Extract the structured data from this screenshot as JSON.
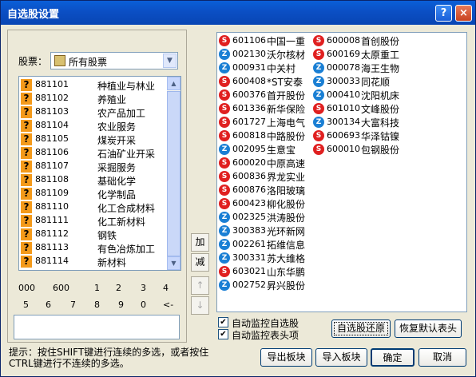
{
  "window": {
    "title": "自选股设置",
    "help_label": "?",
    "close_label": "×"
  },
  "stock_label": "股票：",
  "combo": {
    "value": "所有股票",
    "arrow": "▼"
  },
  "left_items": [
    {
      "code": "881101",
      "name": "种植业与林业"
    },
    {
      "code": "881102",
      "name": "养殖业"
    },
    {
      "code": "881103",
      "name": "农产品加工"
    },
    {
      "code": "881104",
      "name": "农业服务"
    },
    {
      "code": "881105",
      "name": "煤炭开采"
    },
    {
      "code": "881106",
      "name": "石油矿业开采"
    },
    {
      "code": "881107",
      "name": "采掘服务"
    },
    {
      "code": "881108",
      "name": "基础化学"
    },
    {
      "code": "881109",
      "name": "化学制品"
    },
    {
      "code": "881110",
      "name": "化工合成材料"
    },
    {
      "code": "881111",
      "name": "化工新材料"
    },
    {
      "code": "881112",
      "name": "钢铁"
    },
    {
      "code": "881113",
      "name": "有色冶炼加工"
    },
    {
      "code": "881114",
      "name": "新材料"
    }
  ],
  "keypad_row1": [
    "000",
    "600",
    "1",
    "2",
    "3",
    "4"
  ],
  "keypad_row2": [
    "5",
    "6",
    "7",
    "8",
    "9",
    "0",
    "<-"
  ],
  "add_label": "加",
  "remove_label": "减",
  "up_label": "↑",
  "down_label": "↓",
  "right_col1": [
    {
      "code": "601106",
      "name": "中国一重",
      "market": "sh"
    },
    {
      "code": "002130",
      "name": "沃尔核材",
      "market": "sz"
    },
    {
      "code": "000931",
      "name": "中关村",
      "market": "sz"
    },
    {
      "code": "600408",
      "name": "*ST安泰",
      "market": "sh"
    },
    {
      "code": "600376",
      "name": "首开股份",
      "market": "sh"
    },
    {
      "code": "601336",
      "name": "新华保险",
      "market": "sh"
    },
    {
      "code": "601727",
      "name": "上海电气",
      "market": "sh"
    },
    {
      "code": "600818",
      "name": "中路股份",
      "market": "sh"
    },
    {
      "code": "002095",
      "name": "生意宝",
      "market": "sz"
    },
    {
      "code": "600020",
      "name": "中原高速",
      "market": "sh"
    },
    {
      "code": "600836",
      "name": "界龙实业",
      "market": "sh"
    },
    {
      "code": "600876",
      "name": "洛阳玻璃",
      "market": "sh"
    },
    {
      "code": "600423",
      "name": "柳化股份",
      "market": "sh"
    },
    {
      "code": "002325",
      "name": "洪涛股份",
      "market": "sz"
    },
    {
      "code": "300383",
      "name": "光环新网",
      "market": "sz"
    },
    {
      "code": "002261",
      "name": "拓维信息",
      "market": "sz"
    },
    {
      "code": "300331",
      "name": "苏大维格",
      "market": "sz"
    },
    {
      "code": "603021",
      "name": "山东华鹏",
      "market": "sh"
    },
    {
      "code": "002752",
      "name": "昇兴股份",
      "market": "sz"
    }
  ],
  "right_col2": [
    {
      "code": "600008",
      "name": "首创股份",
      "market": "sh"
    },
    {
      "code": "600169",
      "name": "太原重工",
      "market": "sh"
    },
    {
      "code": "000078",
      "name": "海王生物",
      "market": "sz"
    },
    {
      "code": "300033",
      "name": "同花顺",
      "market": "sz"
    },
    {
      "code": "000410",
      "name": "沈阳机床",
      "market": "sz"
    },
    {
      "code": "601010",
      "name": "文峰股份",
      "market": "sh"
    },
    {
      "code": "300134",
      "name": "大富科技",
      "market": "sz"
    },
    {
      "code": "600693",
      "name": "华泽钴镍",
      "market": "sh"
    },
    {
      "code": "600010",
      "name": "包钢股份",
      "market": "sh"
    }
  ],
  "check1": {
    "label": "自动监控自选股",
    "checked": true
  },
  "check2": {
    "label": "自动监控表头项",
    "checked": true
  },
  "restore_label": "自选股还原",
  "reset_header_label": "恢复默认表头",
  "hint": "提示：按住SHIFT键进行连续的多选，或者按住CTRL键进行不连续的多选。",
  "export_label": "导出板块",
  "import_label": "导入板块",
  "ok_label": "确定",
  "cancel_label": "取消",
  "colors": {
    "sh": "#e02020",
    "sz": "#1a7fd4",
    "accent": "#0a5fd8"
  }
}
